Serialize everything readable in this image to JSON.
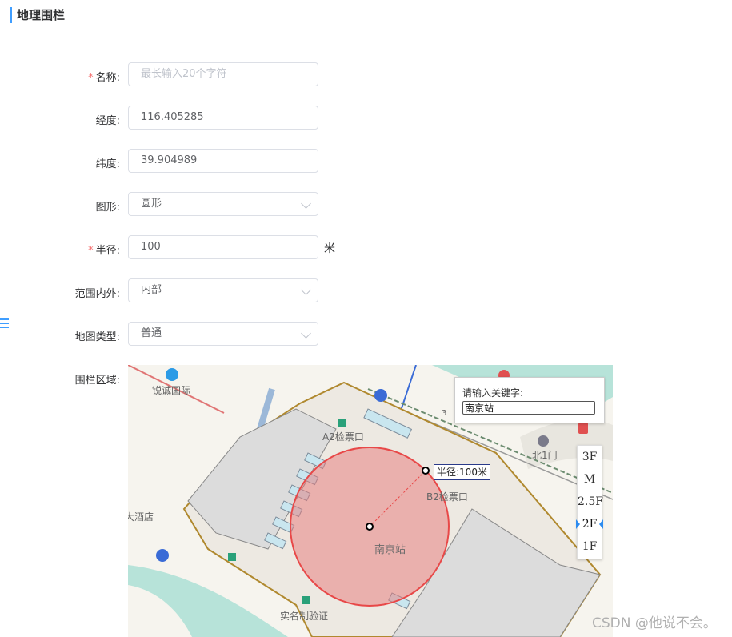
{
  "header": {
    "title": "地理围栏"
  },
  "form": {
    "name": {
      "label": "名称:",
      "required": true,
      "placeholder": "最长输入20个字符",
      "value": ""
    },
    "longitude": {
      "label": "经度:",
      "value": "116.405285"
    },
    "latitude": {
      "label": "纬度:",
      "value": "39.904989"
    },
    "shape": {
      "label": "图形:",
      "value": "圆形"
    },
    "radius": {
      "label": "半径:",
      "required": true,
      "value": "100",
      "unit": "米"
    },
    "scope": {
      "label": "范围内外:",
      "value": "内部"
    },
    "map_type": {
      "label": "地图类型:",
      "value": "普通"
    },
    "area": {
      "label": "围栏区域:"
    }
  },
  "map": {
    "search_title": "请输入关键字:",
    "search_value": "南京站",
    "radius_label": "半径:100米",
    "floors": [
      "3F",
      "M",
      "2.5F",
      "2F",
      "1F"
    ],
    "active_floor": "2F",
    "places": {
      "ruicheng": "锐诚国际",
      "a2_gate": "A2检票口",
      "b2_gate": "B2检票口",
      "station": "南京站",
      "north_gate": "北1门",
      "hotel": "大酒店",
      "realname": "实名制验证"
    },
    "road_number": "3",
    "colors": {
      "circle_fill": "#e8777780",
      "circle_stroke": "#e84848",
      "water": "#b7e3d9"
    }
  },
  "watermark": "CSDN @他说不会。"
}
